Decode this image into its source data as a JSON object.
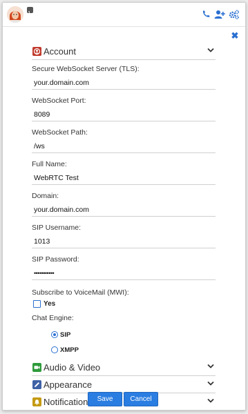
{
  "header": {
    "avatar": "avatar-icon",
    "status": "phone-status-icon",
    "actions": [
      "phone-icon",
      "add-user-icon",
      "settings-icon"
    ],
    "accent": "#2a6fd1"
  },
  "close": {
    "label": "✖"
  },
  "sections": {
    "account": {
      "label": "Account",
      "icon": "account-icon",
      "color": "#c0392b"
    },
    "audio_video": {
      "label": "Audio & Video",
      "icon": "video-icon",
      "color": "#2e9b3b"
    },
    "appearance": {
      "label": "Appearance",
      "icon": "pen-icon",
      "color": "#3f62a6"
    },
    "notifications": {
      "label": "Notifications",
      "icon": "bell-icon",
      "color": "#c49a12"
    }
  },
  "fields": {
    "wss_server": {
      "label": "Secure WebSocket Server (TLS):",
      "value": "your.domain.com"
    },
    "ws_port": {
      "label": "WebSocket Port:",
      "value": "8089"
    },
    "ws_path": {
      "label": "WebSocket Path:",
      "value": "/ws"
    },
    "full_name": {
      "label": "Full Name:",
      "value": "WebRTC Test"
    },
    "domain": {
      "label": "Domain:",
      "value": "your.domain.com"
    },
    "sip_username": {
      "label": "SIP Username:",
      "value": "1013"
    },
    "sip_password": {
      "label": "SIP Password:",
      "value": "•••••••••••"
    }
  },
  "voicemail": {
    "label": "Subscribe to VoiceMail (MWI):",
    "option": "Yes",
    "checked": false
  },
  "chat_engine": {
    "label": "Chat Engine:",
    "options": [
      {
        "label": "SIP",
        "selected": true
      },
      {
        "label": "XMPP",
        "selected": false
      }
    ]
  },
  "buttons": {
    "save": "Save",
    "cancel": "Cancel"
  }
}
